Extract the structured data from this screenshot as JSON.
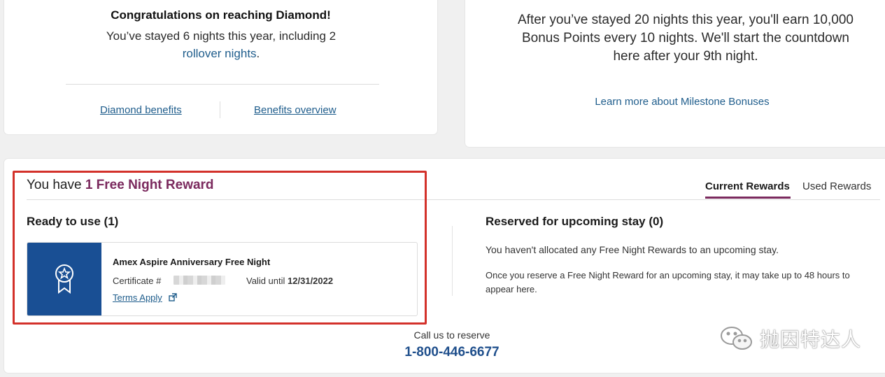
{
  "diamond_card": {
    "title": "Congratulations on reaching Diamond!",
    "body_prefix": "You’ve stayed 6 nights this year, including 2",
    "rollover_link": "rollover nights",
    "body_suffix": ".",
    "link_diamond_benefits": "Diamond benefits",
    "link_benefits_overview": "Benefits overview"
  },
  "milestone_card": {
    "body": "After you’ve stayed 20 nights this year, you'll earn 10,000 Bonus Points every 10 nights. We'll start the countdown here after your 9th night.",
    "link": "Learn more about Milestone Bonuses"
  },
  "rewards": {
    "headline_prefix": "You have",
    "headline_accent": "1 Free Night Reward",
    "tabs": [
      {
        "label": "Current Rewards",
        "active": true
      },
      {
        "label": "Used Rewards",
        "active": false
      }
    ],
    "ready_title": "Ready to use (1)",
    "certificate": {
      "name": "Amex Aspire Anniversary Free Night",
      "certificate_label": "Certificate #",
      "valid_label": "Valid until",
      "valid_date": "12/31/2022",
      "terms_link": "Terms Apply",
      "badge_icon": "award-ribbon-star-icon"
    },
    "reserved_title": "Reserved for upcoming stay (0)",
    "reserved_message": "You haven't allocated any Free Night Rewards to an upcoming stay.",
    "reserved_note": "Once you reserve a Free Night Reward for an upcoming stay, it may take up to 48 hours to appear here.",
    "call_label": "Call us to reserve",
    "call_number": "1-800-446-6677"
  },
  "watermark": {
    "text": "抛因特达人",
    "icon": "wechat-icon"
  },
  "colors": {
    "accent": "#7b2a5e",
    "link": "#1f5d8c",
    "badge_bg": "#194f94",
    "highlight": "#d3312a"
  }
}
